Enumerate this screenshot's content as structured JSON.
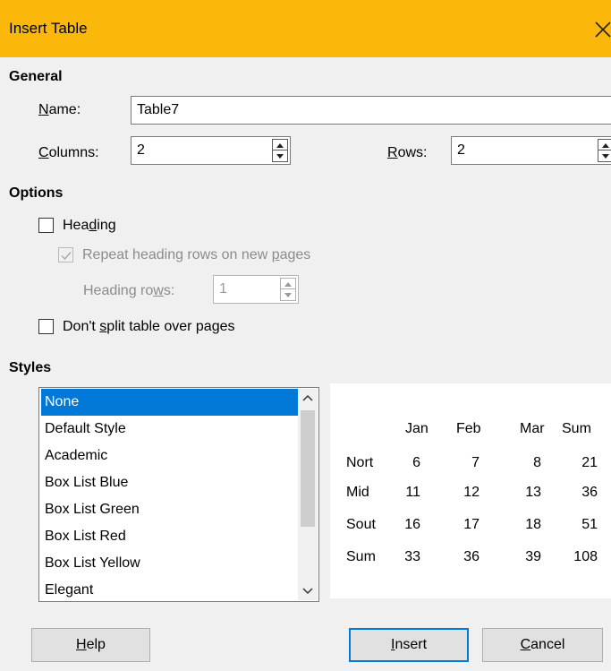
{
  "dialog": {
    "title": "Insert Table"
  },
  "general": {
    "heading": "General",
    "name_label": "Name:",
    "name_value": "Table7",
    "columns_label": "Columns:",
    "columns_value": "2",
    "rows_label": "Rows:",
    "rows_value": "2"
  },
  "options": {
    "heading": "Options",
    "heading_label": "Heading",
    "heading_checked": false,
    "repeat_label": "Repeat heading rows on new pages",
    "repeat_checked": true,
    "heading_rows_label": "Heading rows:",
    "heading_rows_value": "1",
    "nosplit_label": "Don't split table over pages",
    "nosplit_checked": false
  },
  "styles": {
    "heading": "Styles",
    "items": [
      "None",
      "Default Style",
      "Academic",
      "Box List Blue",
      "Box List Green",
      "Box List Red",
      "Box List Yellow",
      "Elegant"
    ],
    "selected": "None"
  },
  "preview": {
    "columns": [
      "Jan",
      "Feb",
      "Mar",
      "Sum"
    ],
    "rows": [
      {
        "label": "Nort",
        "values": [
          "6",
          "7",
          "8",
          "21"
        ]
      },
      {
        "label": "Mid",
        "values": [
          "11",
          "12",
          "13",
          "36"
        ]
      },
      {
        "label": "Sout",
        "values": [
          "16",
          "17",
          "18",
          "51"
        ]
      },
      {
        "label": "Sum",
        "values": [
          "33",
          "36",
          "39",
          "108"
        ]
      }
    ]
  },
  "buttons": {
    "help": "Help",
    "insert": "Insert",
    "cancel": "Cancel"
  },
  "colors": {
    "titlebar": "#fbb80a",
    "selection": "#0078d7",
    "default_button_border": "#0078d7"
  }
}
